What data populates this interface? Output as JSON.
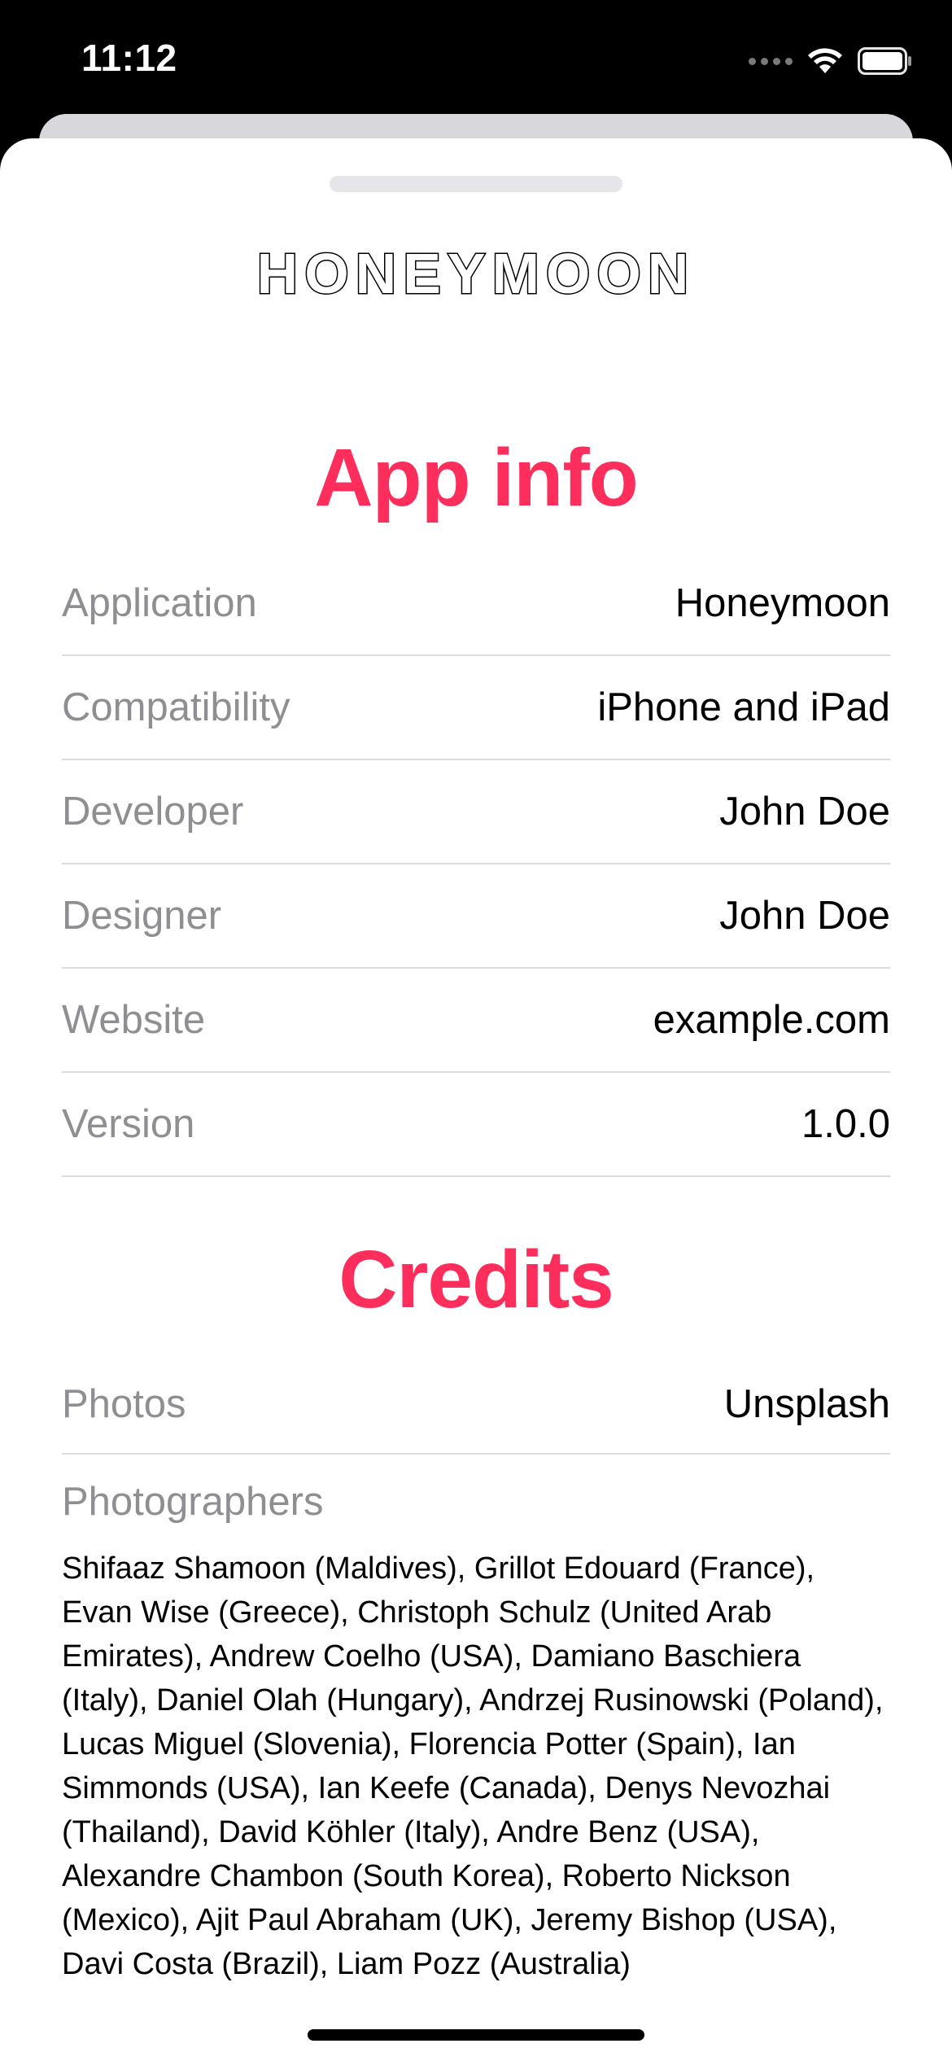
{
  "status_bar": {
    "time": "11:12"
  },
  "logo": {
    "text": "HONEYMOON"
  },
  "app_info": {
    "title": "App info",
    "rows": [
      {
        "label": "Application",
        "value": "Honeymoon"
      },
      {
        "label": "Compatibility",
        "value": "iPhone and iPad"
      },
      {
        "label": "Developer",
        "value": "John Doe"
      },
      {
        "label": "Designer",
        "value": "John Doe"
      },
      {
        "label": "Website",
        "value": "example.com"
      },
      {
        "label": "Version",
        "value": "1.0.0"
      }
    ]
  },
  "credits": {
    "title": "Credits",
    "rows": [
      {
        "label": "Photos",
        "value": "Unsplash"
      }
    ],
    "photographers_label": "Photographers",
    "photographers_text": "Shifaaz Shamoon (Maldives), Grillot Edouard (France), Evan Wise (Greece), Christoph Schulz (United Arab Emirates), Andrew Coelho (USA), Damiano Baschiera (Italy), Daniel Olah (Hungary), Andrzej Rusinowski (Poland), Lucas Miguel (Slovenia), Florencia Potter (Spain), Ian Simmonds (USA), Ian Keefe (Canada), Denys Nevozhai (Thailand), David Köhler (Italy), Andre Benz (USA), Alexandre Chambon (South Korea), Roberto Nickson (Mexico), Ajit Paul Abraham (UK), Jeremy Bishop (USA), Davi Costa (Brazil), Liam Pozz (Australia)"
  },
  "colors": {
    "accent": "#fe2e5c",
    "label_gray": "#8e8e93",
    "divider": "#dcdce0"
  }
}
